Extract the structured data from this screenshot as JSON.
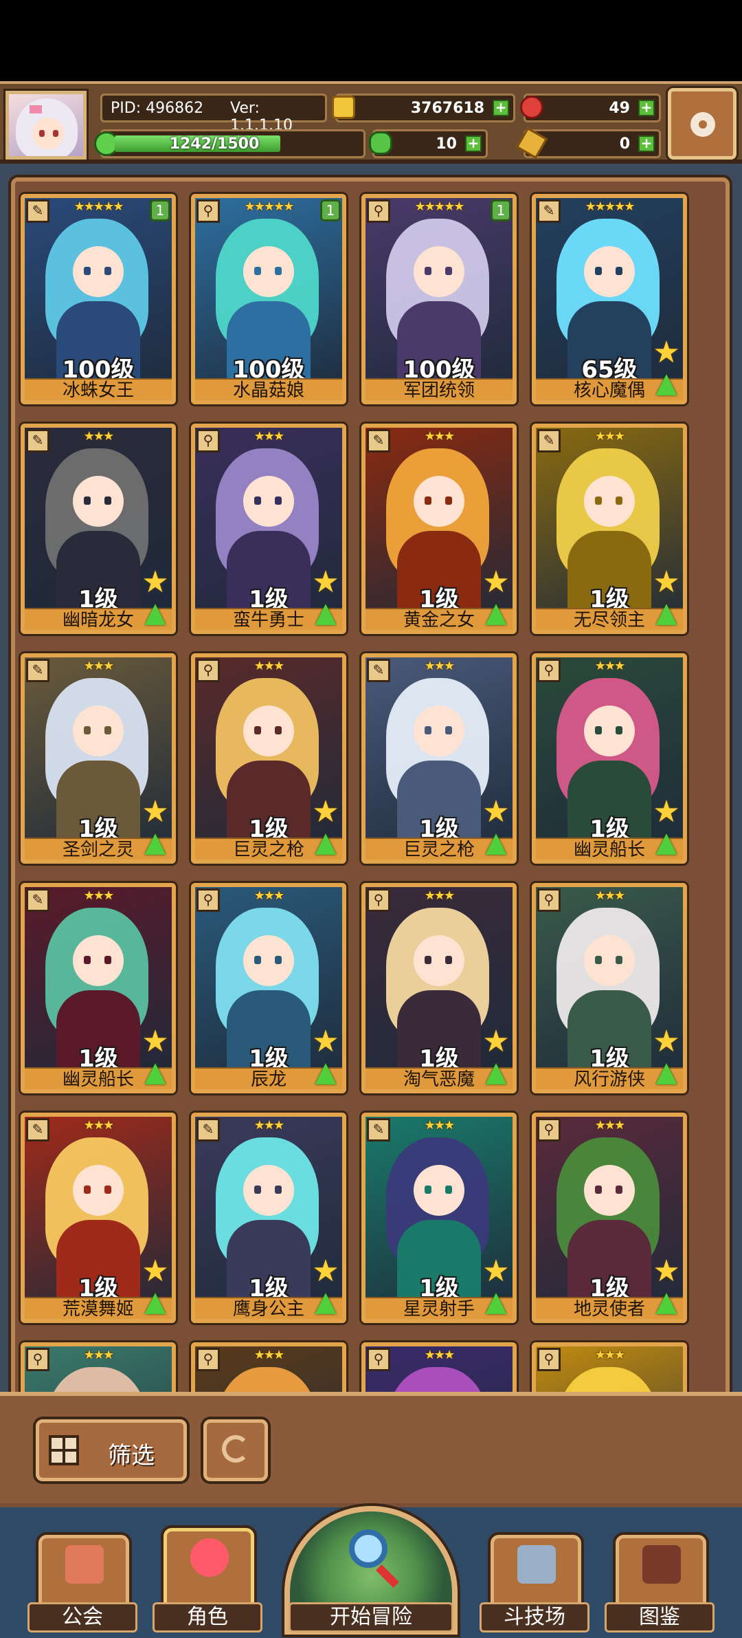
{
  "header": {
    "pid": "PID: 496862",
    "version": "Ver: 1.1.1.10",
    "gold": "3767618",
    "gems": "49",
    "xp": "1242/1500",
    "xp_fraction": 0.83,
    "clovers": "10",
    "keys": "0"
  },
  "cards": [
    {
      "name": "冰蛛女王",
      "level": "100级",
      "stars": "★★★★★",
      "badge": "1",
      "type": "✎",
      "colors": [
        "#5fc8e6",
        "#2a4a7a"
      ]
    },
    {
      "name": "水晶菇娘",
      "level": "100级",
      "stars": "★★★★★",
      "badge": "1",
      "type": "⚲",
      "colors": [
        "#4fd7c9",
        "#2d6fa0"
      ]
    },
    {
      "name": "军团统领",
      "level": "100级",
      "stars": "★★★★★",
      "badge": "1",
      "type": "⚲",
      "colors": [
        "#cfc8e8",
        "#4a3a6a"
      ]
    },
    {
      "name": "核心魔偶",
      "level": "65级",
      "stars": "★★★★★",
      "badge": "",
      "type": "✎",
      "colors": [
        "#6fe0ff",
        "#23405e"
      ]
    },
    {
      "name": "幽暗龙女",
      "level": "1级",
      "stars": "★★★",
      "badge": "",
      "type": "✎",
      "colors": [
        "#707070",
        "#2a2a3a"
      ]
    },
    {
      "name": "蛮牛勇士",
      "level": "1级",
      "stars": "★★★",
      "badge": "",
      "type": "⚲",
      "colors": [
        "#9a86c8",
        "#3a2e5a"
      ]
    },
    {
      "name": "黄金之女",
      "level": "1级",
      "stars": "★★★",
      "badge": "",
      "type": "✎",
      "colors": [
        "#f2a53a",
        "#8a2a10"
      ]
    },
    {
      "name": "无尽领主",
      "level": "1级",
      "stars": "★★★",
      "badge": "",
      "type": "✎",
      "colors": [
        "#f0cf4a",
        "#8a6a10"
      ]
    },
    {
      "name": "圣剑之灵",
      "level": "1级",
      "stars": "★★★",
      "badge": "",
      "type": "✎",
      "colors": [
        "#d8e2f0",
        "#6a5a3a"
      ]
    },
    {
      "name": "巨灵之枪",
      "level": "1级",
      "stars": "★★★",
      "badge": "",
      "type": "⚲",
      "colors": [
        "#f0c060",
        "#5a2a2a"
      ]
    },
    {
      "name": "巨灵之枪",
      "level": "1级",
      "stars": "★★★",
      "badge": "",
      "type": "✎",
      "colors": [
        "#e6eef8",
        "#4a5a7a"
      ]
    },
    {
      "name": "幽灵船长",
      "level": "1级",
      "stars": "★★★",
      "badge": "",
      "type": "⚲",
      "colors": [
        "#d85a8a",
        "#2a4a3a"
      ]
    },
    {
      "name": "幽灵船长",
      "level": "1级",
      "stars": "★★★",
      "badge": "",
      "type": "✎",
      "colors": [
        "#5ac0a0",
        "#5a1a2a"
      ]
    },
    {
      "name": "辰龙",
      "level": "1级",
      "stars": "★★★",
      "badge": "",
      "type": "⚲",
      "colors": [
        "#7fdff0",
        "#2a5a7a"
      ]
    },
    {
      "name": "淘气恶魔",
      "level": "1级",
      "stars": "★★★",
      "badge": "",
      "type": "⚲",
      "colors": [
        "#f6d8a0",
        "#3a2a3a"
      ]
    },
    {
      "name": "风行游侠",
      "level": "1级",
      "stars": "★★★",
      "badge": "",
      "type": "⚲",
      "colors": [
        "#ece8ea",
        "#3a5a4a"
      ]
    },
    {
      "name": "荒漠舞姬",
      "level": "1级",
      "stars": "★★★",
      "badge": "",
      "type": "✎",
      "colors": [
        "#f8c860",
        "#a02a1a"
      ]
    },
    {
      "name": "鹰身公主",
      "level": "1级",
      "stars": "★★★",
      "badge": "",
      "type": "✎",
      "colors": [
        "#6fe6e8",
        "#3a3a5a"
      ]
    },
    {
      "name": "星灵射手",
      "level": "1级",
      "stars": "★★★",
      "badge": "",
      "type": "✎",
      "colors": [
        "#3a3a7a",
        "#1a7a6a"
      ]
    },
    {
      "name": "地灵使者",
      "level": "1级",
      "stars": "★★★",
      "badge": "",
      "type": "⚲",
      "colors": [
        "#4a8a3a",
        "#5a2a3a"
      ]
    },
    {
      "name": "",
      "level": "",
      "stars": "★★★",
      "badge": "",
      "type": "⚲",
      "colors": [
        "#e8c0a8",
        "#3a7a6a"
      ]
    },
    {
      "name": "",
      "level": "",
      "stars": "★★★",
      "badge": "",
      "type": "⚲",
      "colors": [
        "#f0a040",
        "#5a3a1a"
      ]
    },
    {
      "name": "",
      "level": "",
      "stars": "★★★",
      "badge": "",
      "type": "⚲",
      "colors": [
        "#b050c0",
        "#3a2a6a"
      ]
    },
    {
      "name": "",
      "level": "",
      "stars": "★★★",
      "badge": "",
      "type": "⚲",
      "colors": [
        "#f8d040",
        "#c08a10"
      ]
    }
  ],
  "controls": {
    "filter_label": "筛选"
  },
  "nav": {
    "guild": "公会",
    "role": "角色",
    "adventure": "开始冒险",
    "arena": "斗技场",
    "codex": "图鉴"
  }
}
